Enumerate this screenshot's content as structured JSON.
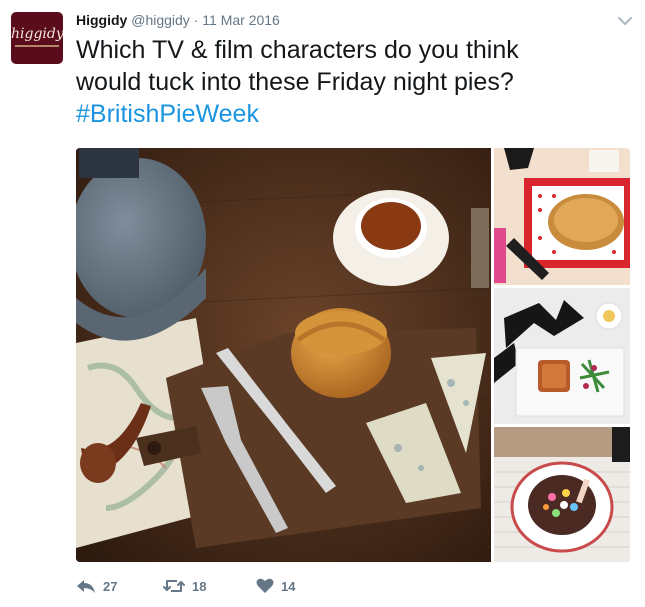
{
  "tweet": {
    "avatar_text": "higgidy",
    "display_name": "Higgidy",
    "handle": "@higgidy",
    "separator": "·",
    "date": "11 Mar 2016",
    "text_line1": "Which TV & film characters do you think",
    "text_line2": "would tuck into these Friday night pies?",
    "hashtag": "#BritishPieWeek",
    "caret_icon": "chevron-down-icon"
  },
  "media": {
    "photos": [
      {
        "description_icon": "photo-pie-cheese-board"
      },
      {
        "description_icon": "photo-pie-tv-remote"
      },
      {
        "description_icon": "photo-pie-bowtie-plate"
      },
      {
        "description_icon": "photo-pie-sweets-bowl"
      }
    ]
  },
  "actions": {
    "reply_count": "27",
    "retweet_count": "18",
    "like_count": "14",
    "reply_icon": "reply-icon",
    "retweet_icon": "retweet-icon",
    "like_icon": "heart-icon"
  },
  "colors": {
    "brand": "#5a0c1c",
    "link": "#1b95e0",
    "muted": "#657786",
    "text": "#14171a"
  }
}
